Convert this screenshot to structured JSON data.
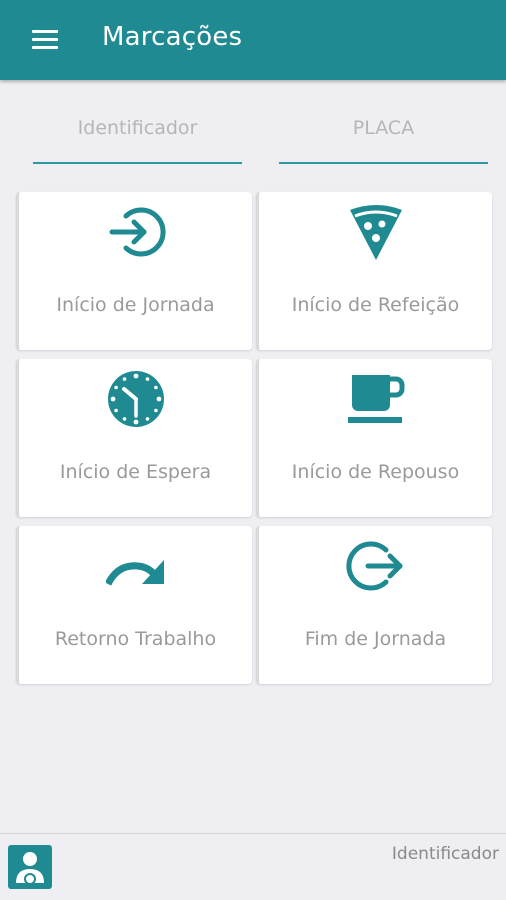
{
  "header": {
    "title": "Marcações",
    "menu_icon": "menu-icon"
  },
  "fields": {
    "identificador": {
      "placeholder": "Identificador",
      "value": ""
    },
    "placa": {
      "placeholder": "PLACA",
      "value": ""
    }
  },
  "tiles": [
    {
      "label": "Início de Jornada",
      "icon": "login-icon"
    },
    {
      "label": "Início de Refeição",
      "icon": "pizza-icon"
    },
    {
      "label": "Início de Espera",
      "icon": "clock-icon"
    },
    {
      "label": "Início de Repouso",
      "icon": "coffee-cup-icon"
    },
    {
      "label": "Retorno Trabalho",
      "icon": "redo-arrow-icon"
    },
    {
      "label": "Fim de Jornada",
      "icon": "logout-icon"
    }
  ],
  "footer": {
    "identifier_label": "Identificador",
    "avatar_icon": "driver-avatar-icon"
  },
  "colors": {
    "primary": "#1f8a91",
    "background": "#eeeef3",
    "label_text": "#9a9a9a"
  }
}
